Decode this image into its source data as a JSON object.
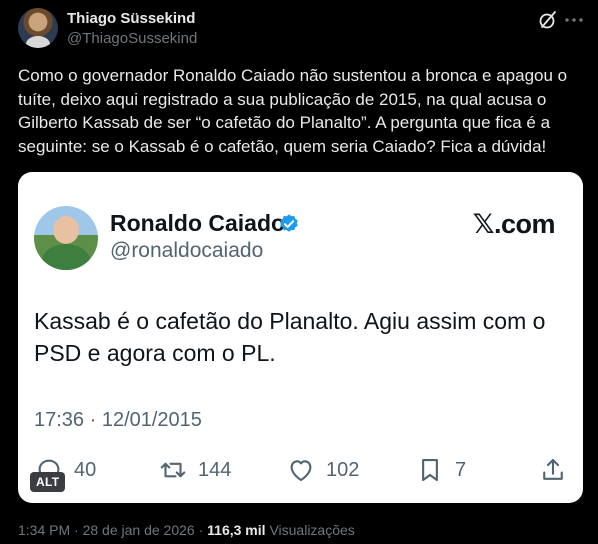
{
  "author": {
    "name": "Thiago Süssekind",
    "handle": "@ThiagoSussekind"
  },
  "icons": {
    "grok": "grok-icon",
    "more": "more-icon"
  },
  "tweet": {
    "text": "Como o governador Ronaldo Caiado não sustentou a bronca e apagou o tuíte, deixo aqui registrado a sua publicação de 2015, na qual acusa o Gilberto Kassab de ser “o cafetão do Planalto”. A pergunta que fica é a seguinte: se o Kassab é o cafetão, quem seria Caiado? Fica a dúvida!"
  },
  "image_card": {
    "name": "Ronaldo Caiado",
    "handle": "@ronaldocaiado",
    "logo": "𝕏.com",
    "text": "Kassab é o cafetão do Planalto. Agiu assim com o PSD e agora com o PL.",
    "time": "17:36 · 12/01/2015",
    "actions": {
      "replies": "40",
      "retweets": "144",
      "likes": "102",
      "bookmarks": "7"
    },
    "alt_label": "ALT",
    "colors": {
      "verified": "#1d9bf0",
      "background": "#ffffff"
    }
  },
  "meta": {
    "time": "1:34 PM",
    "separator": " · ",
    "date": "28 de jan de 2026",
    "views_count": "116,3 mil",
    "views_label": "Visualizações"
  }
}
